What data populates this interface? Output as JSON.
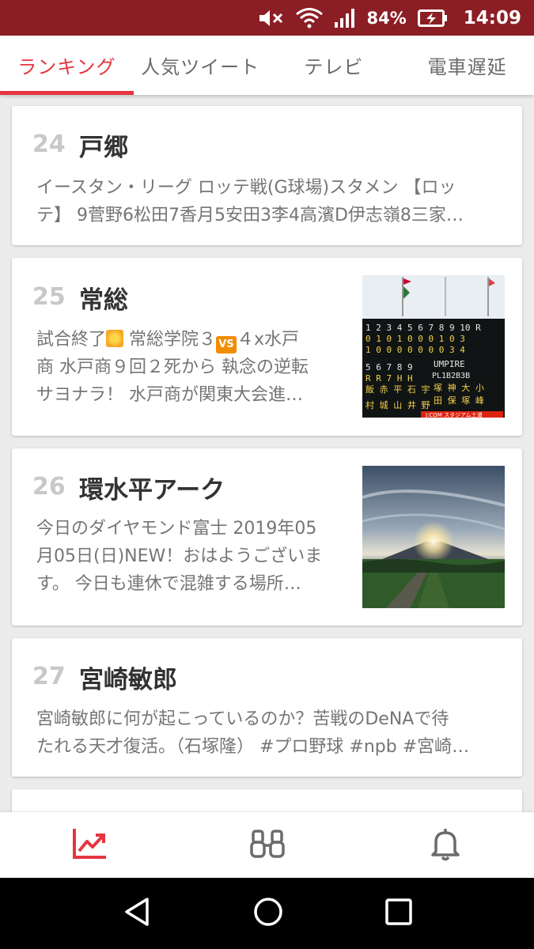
{
  "status_bar": {
    "battery": "84%",
    "time": "14:09",
    "icons": [
      "mute-icon",
      "wifi-icon",
      "signal-icon",
      "battery-charging-icon"
    ]
  },
  "tabs": [
    {
      "label": "ランキング",
      "active": true
    },
    {
      "label": "人気ツイート",
      "active": false
    },
    {
      "label": "テレビ",
      "active": false
    },
    {
      "label": "電車遅延",
      "active": false
    }
  ],
  "accent_color": "#e5353f",
  "status_bar_color": "#8b1e24",
  "items": [
    {
      "rank": "24",
      "title": "戸郷",
      "desc_lines": [
        "イースタン・リーグ ロッテ戦(G球場)スタメン 【ロッ",
        "テ】 9菅野6松田7香月5安田3李4高濱D伊志嶺8三家…"
      ]
    },
    {
      "rank": "25",
      "title": "常総",
      "desc": {
        "l1_a": "試合終了",
        "l1_b": " 常総学院３",
        "l1_c": "４x水戸",
        "l2": "商 水戸商９回２死から 執念の逆転",
        "l3": "サヨナラ！ 水戸商が関東大会進…"
      },
      "thumb": "baseball-scoreboard-image"
    },
    {
      "rank": "26",
      "title": "環水平アーク",
      "desc_lines": [
        "今日のダイヤモンド富士 2019年05",
        "月05日(日)NEW！おはようございま",
        "す。 今日も連休で混雑する場所…"
      ],
      "thumb": "diamond-fuji-photo"
    },
    {
      "rank": "27",
      "title": "宮崎敏郎",
      "desc_lines": [
        "宮崎敏郎に何が起こっているのか？苦戦のDeNAで待",
        "たれる天才復活。（石塚隆） #プロ野球 #npb #宮崎…"
      ]
    }
  ],
  "bottom_nav": [
    {
      "icon": "trending-chart-icon",
      "active": true
    },
    {
      "icon": "binoculars-icon",
      "active": false
    },
    {
      "icon": "bell-icon",
      "active": false
    }
  ],
  "system_nav": [
    "back-icon",
    "home-icon",
    "recents-icon"
  ]
}
